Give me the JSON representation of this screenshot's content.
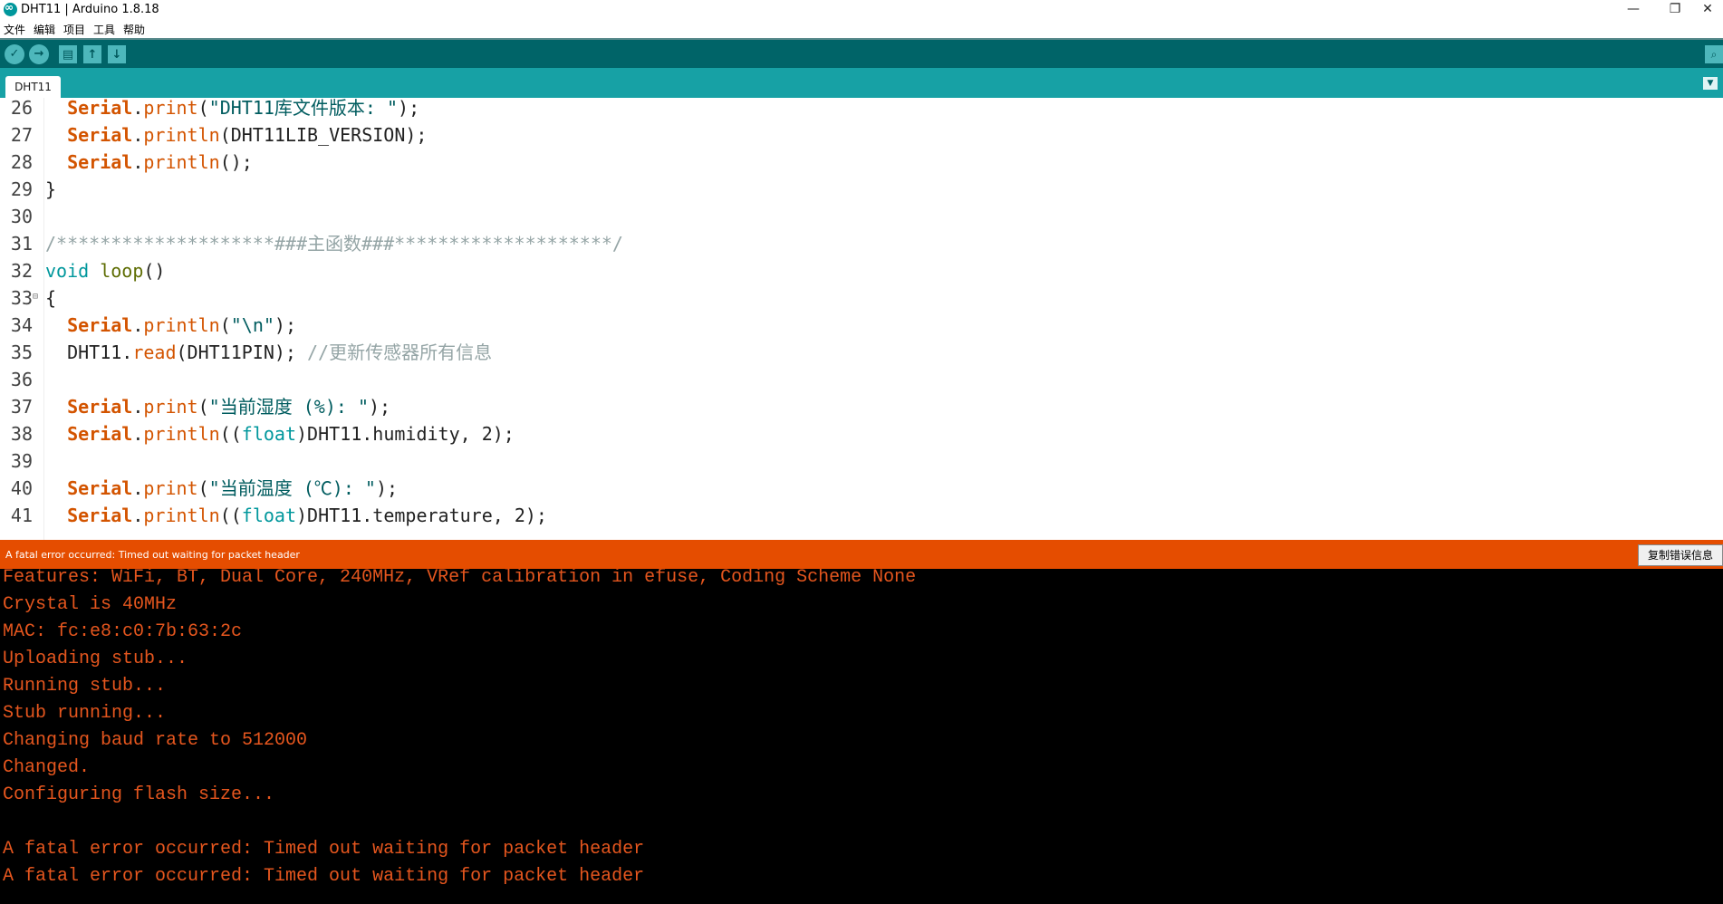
{
  "window": {
    "title": "DHT11 | Arduino 1.8.18",
    "minimize_glyph": "—",
    "restore_glyph": "❐",
    "close_glyph": "✕"
  },
  "menu": [
    "文件",
    "编辑",
    "项目",
    "工具",
    "帮助"
  ],
  "toolbar": {
    "verify_glyph": "✓",
    "upload_glyph": "→",
    "new_glyph": "▤",
    "open_glyph": "↑",
    "save_glyph": "↓",
    "serial_monitor_glyph": "⌕"
  },
  "tabs": {
    "active": "DHT11",
    "menu_glyph": "▼"
  },
  "editor": {
    "lines": [
      {
        "n": "26",
        "parts": [
          [
            "",
            "  "
          ],
          [
            "kw-serial",
            "Serial"
          ],
          [
            "",
            "."
          ],
          [
            "fn",
            "print"
          ],
          [
            "",
            "("
          ],
          [
            "str",
            "\"DHT11库文件版本: \""
          ],
          [
            "",
            ");"
          ]
        ]
      },
      {
        "n": "27",
        "parts": [
          [
            "",
            "  "
          ],
          [
            "kw-serial",
            "Serial"
          ],
          [
            "",
            "."
          ],
          [
            "fn",
            "println"
          ],
          [
            "",
            "(DHT11LIB_VERSION);"
          ]
        ]
      },
      {
        "n": "28",
        "parts": [
          [
            "",
            "  "
          ],
          [
            "kw-serial",
            "Serial"
          ],
          [
            "",
            "."
          ],
          [
            "fn",
            "println"
          ],
          [
            "",
            "();"
          ]
        ]
      },
      {
        "n": "29",
        "parts": [
          [
            "",
            "}"
          ]
        ]
      },
      {
        "n": "30",
        "parts": []
      },
      {
        "n": "31",
        "parts": [
          [
            "cm",
            "/********************###主函数###********************/"
          ]
        ]
      },
      {
        "n": "32",
        "parts": [
          [
            "ty",
            "void"
          ],
          [
            "",
            " "
          ],
          [
            "lp",
            "loop"
          ],
          [
            "",
            "()"
          ]
        ]
      },
      {
        "n": "33",
        "fold": "⊟",
        "parts": [
          [
            "",
            "{"
          ]
        ]
      },
      {
        "n": "34",
        "parts": [
          [
            "",
            "  "
          ],
          [
            "kw-serial",
            "Serial"
          ],
          [
            "",
            "."
          ],
          [
            "fn",
            "println"
          ],
          [
            "",
            "("
          ],
          [
            "str",
            "\"\\n\""
          ],
          [
            "",
            ");"
          ]
        ]
      },
      {
        "n": "35",
        "parts": [
          [
            "",
            "  DHT11."
          ],
          [
            "fn",
            "read"
          ],
          [
            "",
            "(DHT11PIN); "
          ],
          [
            "cm",
            "//更新传感器所有信息"
          ]
        ]
      },
      {
        "n": "36",
        "parts": []
      },
      {
        "n": "37",
        "parts": [
          [
            "",
            "  "
          ],
          [
            "kw-serial",
            "Serial"
          ],
          [
            "",
            "."
          ],
          [
            "fn",
            "print"
          ],
          [
            "",
            "("
          ],
          [
            "str",
            "\"当前湿度 (%): \""
          ],
          [
            "",
            ");"
          ]
        ]
      },
      {
        "n": "38",
        "parts": [
          [
            "",
            "  "
          ],
          [
            "kw-serial",
            "Serial"
          ],
          [
            "",
            "."
          ],
          [
            "fn",
            "println"
          ],
          [
            "",
            "(("
          ],
          [
            "ty",
            "float"
          ],
          [
            "",
            ")DHT11.humidity, 2);"
          ]
        ]
      },
      {
        "n": "39",
        "parts": []
      },
      {
        "n": "40",
        "parts": [
          [
            "",
            "  "
          ],
          [
            "kw-serial",
            "Serial"
          ],
          [
            "",
            "."
          ],
          [
            "fn",
            "print"
          ],
          [
            "",
            "("
          ],
          [
            "str",
            "\"当前温度 (℃): \""
          ],
          [
            "",
            ");"
          ]
        ]
      },
      {
        "n": "41",
        "parts": [
          [
            "",
            "  "
          ],
          [
            "kw-serial",
            "Serial"
          ],
          [
            "",
            "."
          ],
          [
            "fn",
            "println"
          ],
          [
            "",
            "(("
          ],
          [
            "ty",
            "float"
          ],
          [
            "",
            ")DHT11.temperature, 2);"
          ]
        ]
      }
    ]
  },
  "status": {
    "message": "A fatal error occurred: Timed out waiting for packet header",
    "copy_button": "复制错误信息",
    "color": "#e54d00"
  },
  "console": {
    "lines": [
      "Features: WiFi, BT, Dual Core, 240MHz, VRef calibration in efuse, Coding Scheme None",
      "Crystal is 40MHz",
      "MAC: fc:e8:c0:7b:63:2c",
      "Uploading stub...",
      "Running stub...",
      "Stub running...",
      "Changing baud rate to 512000",
      "Changed.",
      "Configuring flash size...",
      "",
      "A fatal error occurred: Timed out waiting for packet header",
      "A fatal error occurred: Timed out waiting for packet header"
    ]
  }
}
